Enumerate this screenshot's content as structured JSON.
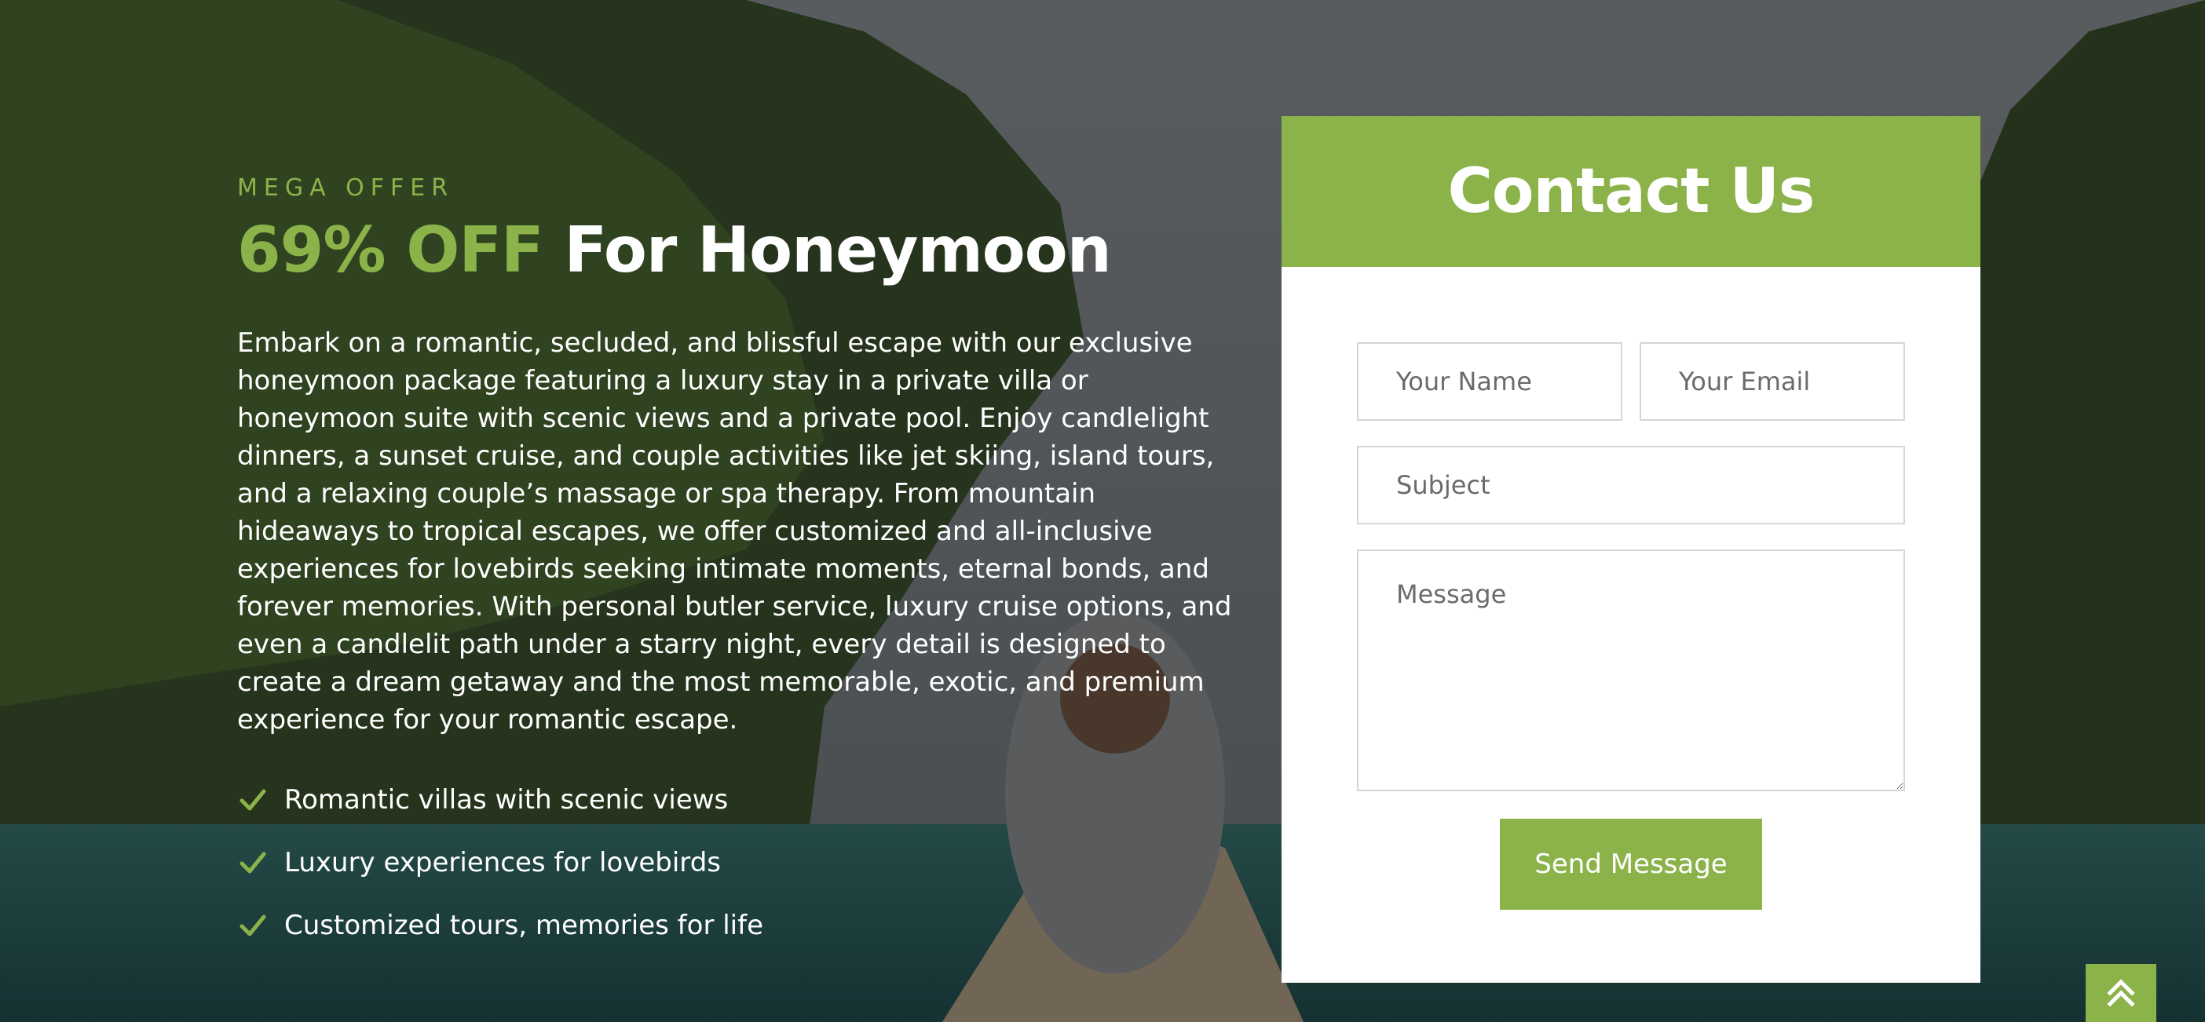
{
  "offer": {
    "eyebrow": "MEGA OFFER",
    "headline_accent": "69% OFF",
    "headline_rest": " For Honeymoon",
    "description": "Embark on a romantic, secluded, and blissful escape with our exclusive honeymoon package featuring a luxury stay in a private villa or honeymoon suite with scenic views and a private pool. Enjoy candlelight dinners, a sunset cruise, and couple activities like jet skiing, island tours, and a relaxing couple’s massage or spa therapy. From mountain hideaways to tropical escapes, we offer customized and all-inclusive experiences for lovebirds seeking intimate moments, eternal bonds, and forever memories. With personal butler service, luxury cruise options, and even a candlelit path under a starry night, every detail is designed to create a dream getaway and the most memorable, exotic, and premium experience for your romantic escape.",
    "features": [
      "Romantic villas with scenic views",
      "Luxury experiences for lovebirds",
      "Customized tours, memories for life"
    ]
  },
  "contact": {
    "title": "Contact Us",
    "name_placeholder": "Your Name",
    "email_placeholder": "Your Email",
    "subject_placeholder": "Subject",
    "message_placeholder": "Message",
    "send_label": "Send Message"
  },
  "colors": {
    "accent": "#8bb34a",
    "white": "#ffffff"
  },
  "icons": {
    "feature": "check-icon",
    "back_to_top": "double-chevron-up-icon"
  }
}
